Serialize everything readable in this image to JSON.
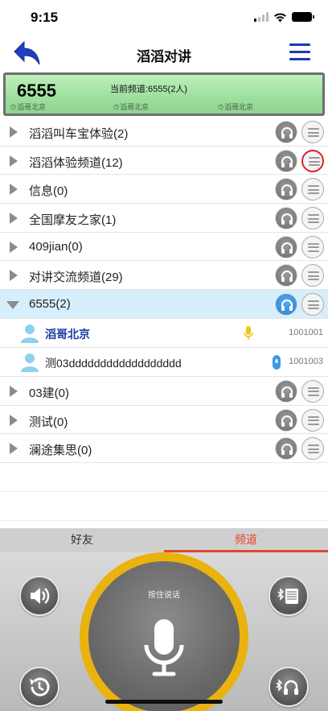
{
  "status": {
    "time": "9:15"
  },
  "nav": {
    "title": "滔滔对讲",
    "back_icon": "back-arrow-icon",
    "menu_icon": "hamburger-menu-icon"
  },
  "panel": {
    "number": "6555",
    "current": "当前频道:6555(2人)",
    "users": [
      "滔哥北京",
      "滔哥北京",
      "滔哥北京"
    ]
  },
  "channels_top": [
    {
      "label": "滔滔叫车宝体验(2)"
    },
    {
      "label": "滔滔体验频道(12)"
    },
    {
      "label": "信息(0)"
    },
    {
      "label": "全国摩友之家(1)"
    },
    {
      "label": "409jian(0)"
    },
    {
      "label": "对讲交流频道(29)"
    }
  ],
  "selected_channel": {
    "label": "6555(2)"
  },
  "members": [
    {
      "name": "滔哥北京",
      "id": "1001001",
      "status_icon": "microphone-icon"
    },
    {
      "name": "测03dddddddddddddddddd",
      "id": "1001003",
      "status_icon": "bluetooth-device-icon"
    }
  ],
  "channels_bottom": [
    {
      "label": "03建(0)"
    },
    {
      "label": "测试(0)"
    },
    {
      "label": "澜途集思(0)"
    }
  ],
  "tabs": {
    "friends": "好友",
    "channels": "频道"
  },
  "ptt": {
    "label": "按住说话"
  },
  "colors": {
    "accent": "#e0482c",
    "ptt_ring": "#e9b20f",
    "selected_row": "#d7eefb",
    "nav_blue": "#1a3bb8"
  }
}
